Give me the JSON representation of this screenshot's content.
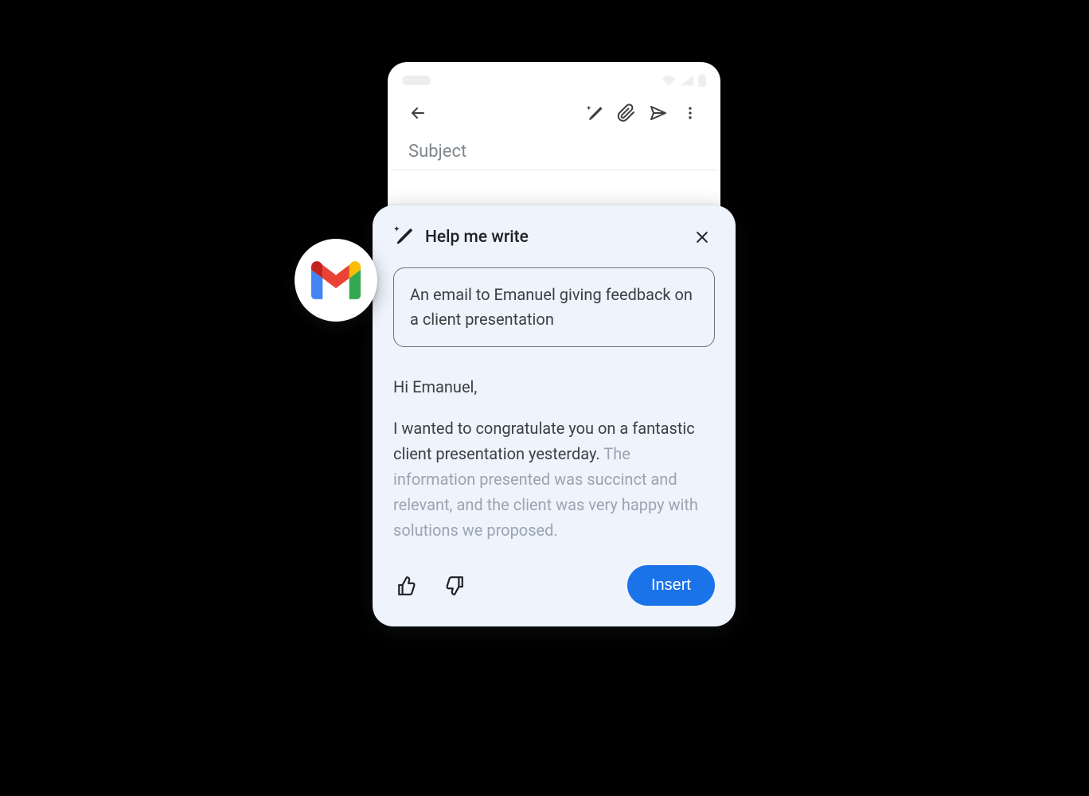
{
  "phone": {
    "subject_placeholder": "Subject"
  },
  "panel": {
    "title": "Help me write",
    "prompt": "An email to Emanuel giving feedback on a client presentation",
    "greeting": "Hi Emanuel,",
    "body_strong": "I wanted to congratulate you on a fantastic client presentation yesterday.",
    "body_faded": "The information presented was succinct and relevant, and the client was very happy with solutions we proposed.",
    "insert_label": "Insert"
  }
}
